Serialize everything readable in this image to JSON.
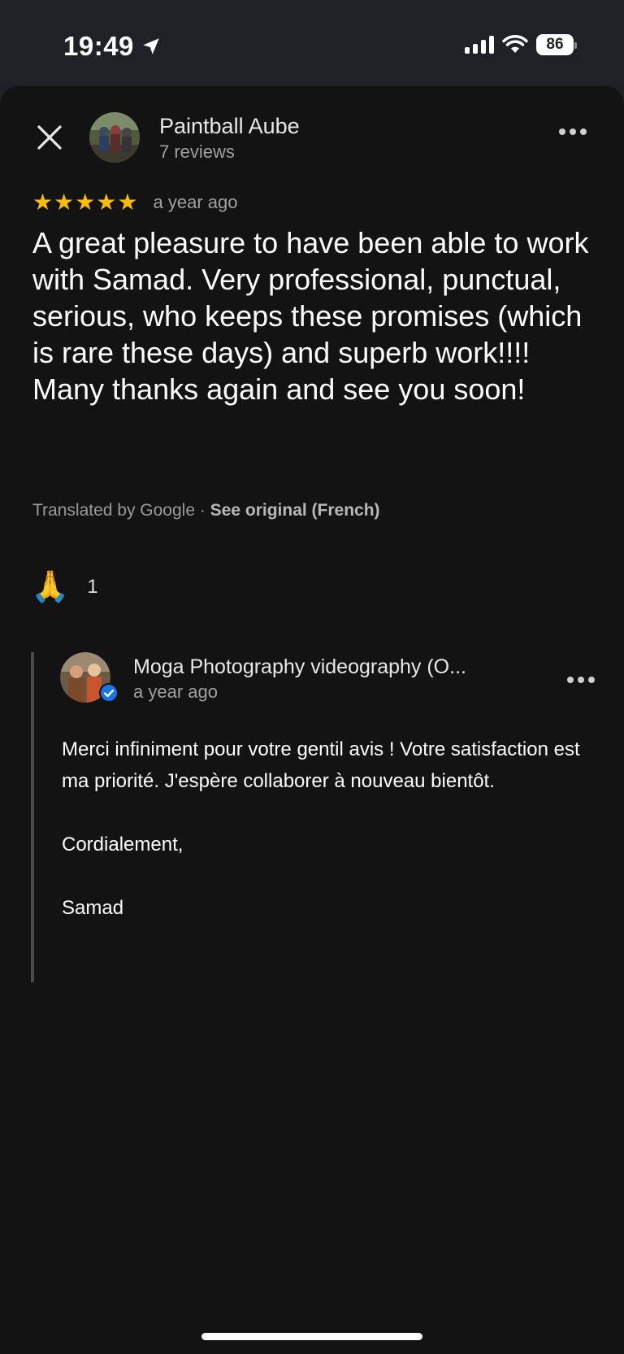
{
  "status_bar": {
    "time": "19:49",
    "battery": "86"
  },
  "review": {
    "reviewer_name": "Paintball Aube",
    "reviewer_reviews": "7 reviews",
    "stars": "★★★★★",
    "rating": 5,
    "time": "a year ago",
    "text_lines": [
      "A great pleasure to have been able to work with Samad. Very professional, punctual, serious, who keeps these promises (which is rare these days) and superb work!!!!",
      "Many thanks again and see you soon!"
    ],
    "translated_by": "Translated by Google · ",
    "see_original": "See original (French)",
    "reaction_emoji": "🙏",
    "reaction_count": "1"
  },
  "owner_reply": {
    "name": "Moga Photography videography (O...",
    "time": "a year ago",
    "paragraphs": [
      "Merci infiniment pour votre gentil avis ! Votre satisfaction est ma priorité. J'espère collaborer à nouveau bientôt.",
      "Cordialement,",
      "Samad"
    ]
  },
  "colors": {
    "star": "#fbbc04",
    "verified": "#1a73e8",
    "background": "#131313"
  }
}
